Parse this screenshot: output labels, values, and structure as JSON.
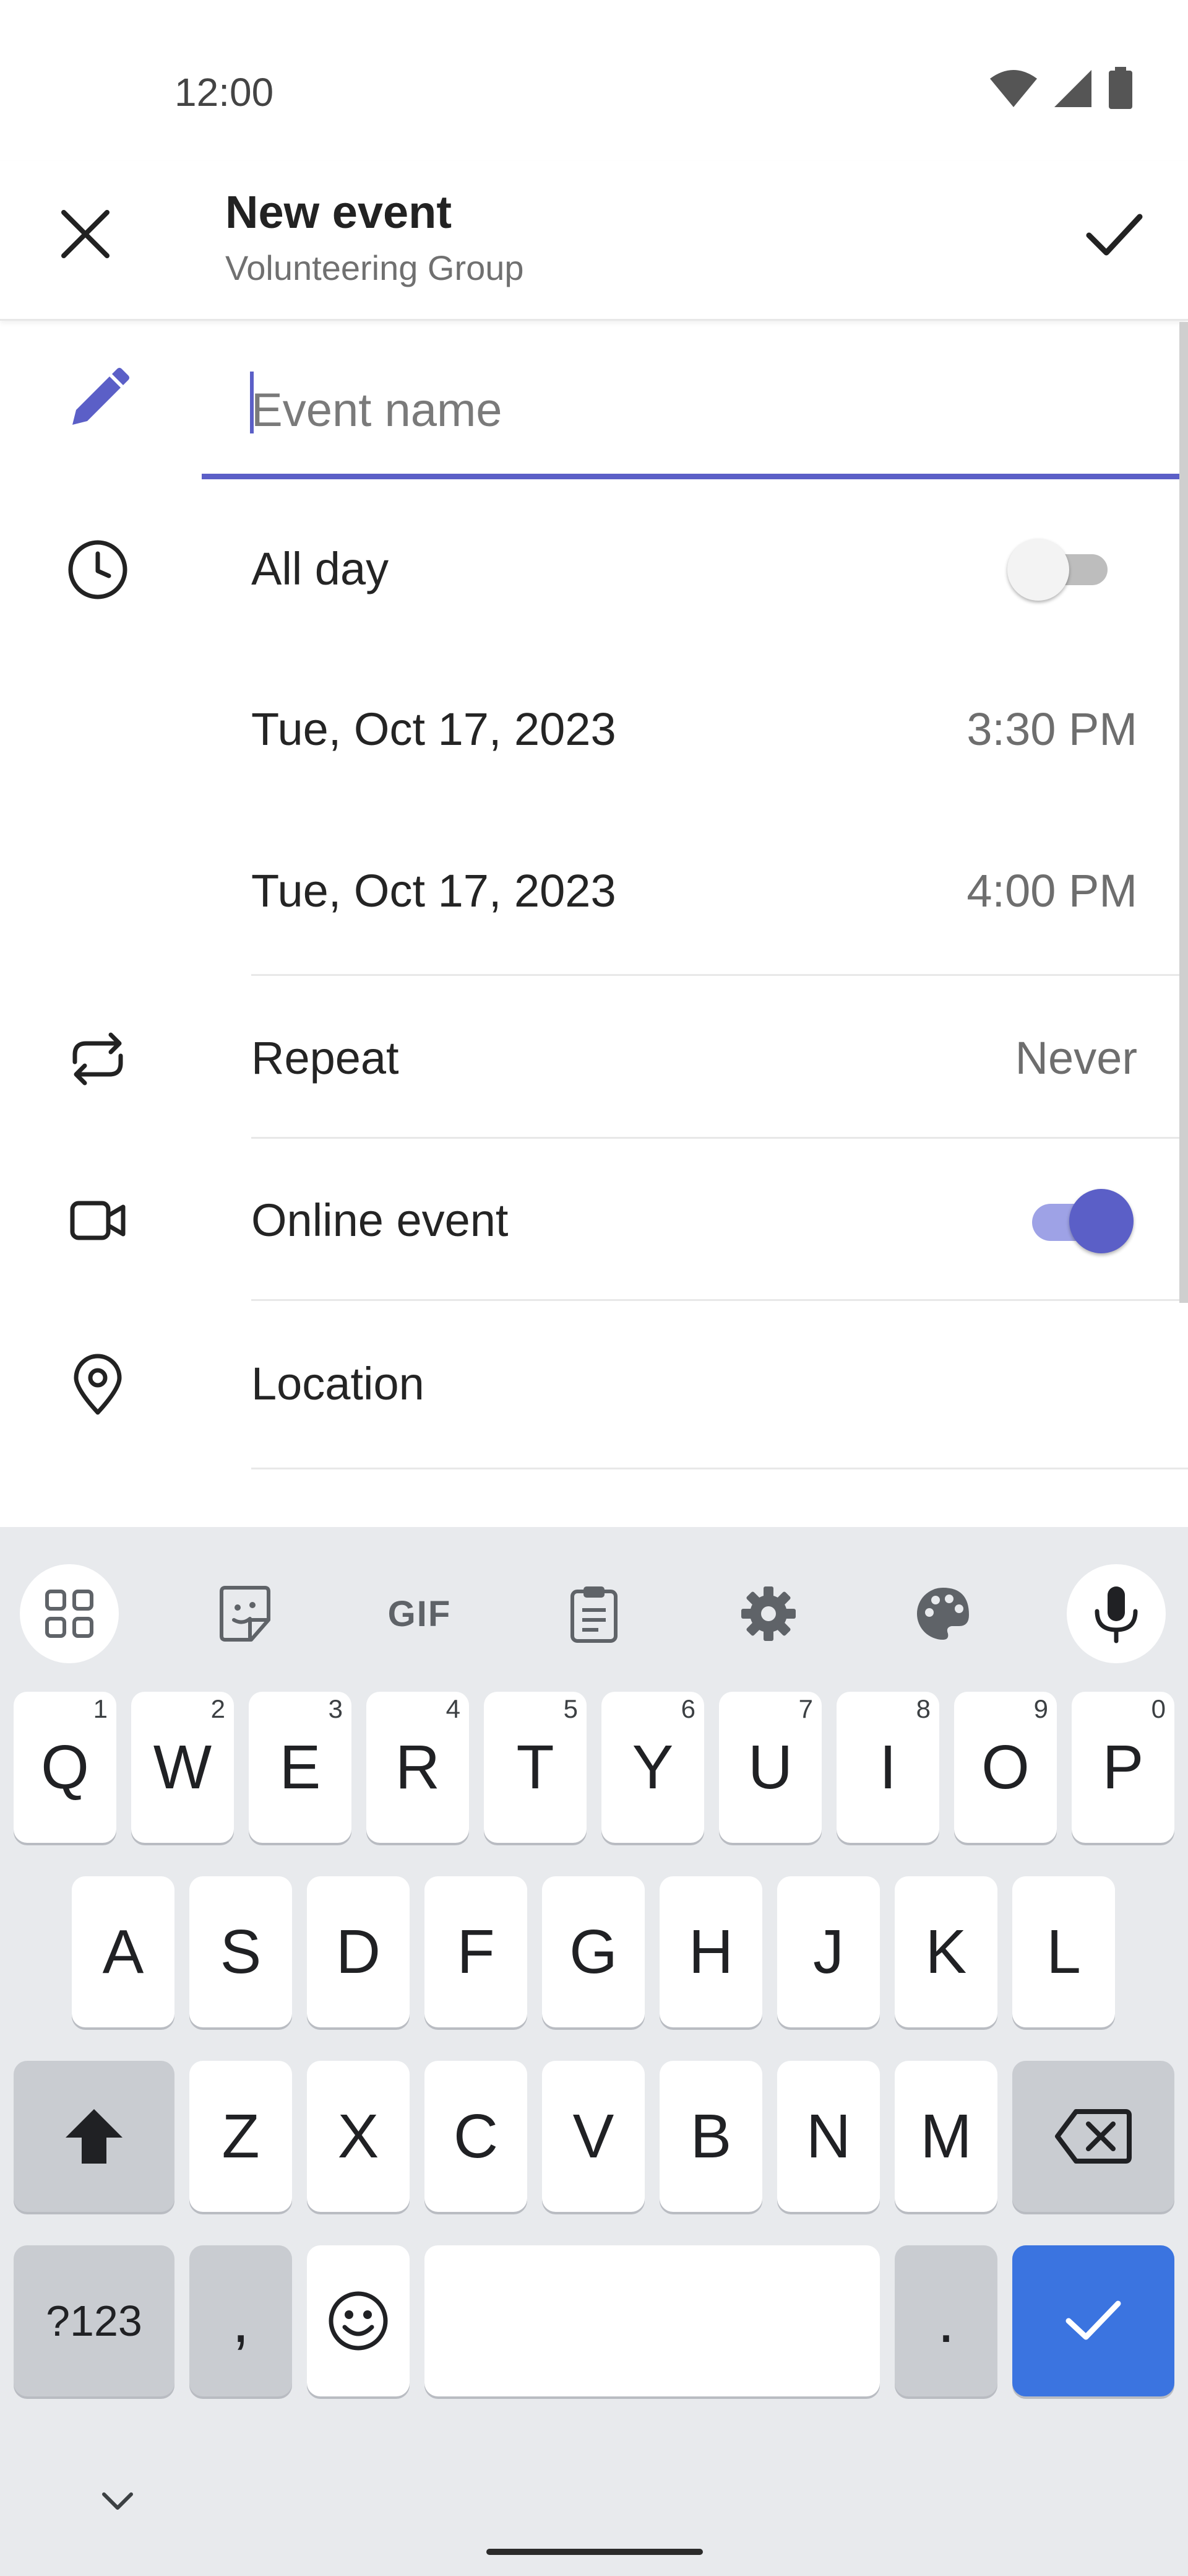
{
  "status_bar": {
    "time": "12:00"
  },
  "header": {
    "title": "New event",
    "subtitle": "Volunteering Group",
    "close_icon": "close-icon",
    "confirm_icon": "check-icon"
  },
  "form": {
    "event_name": {
      "placeholder": "Event name",
      "value": ""
    },
    "all_day": {
      "label": "All day",
      "on": false
    },
    "start": {
      "date": "Tue, Oct 17, 2023",
      "time": "3:30 PM"
    },
    "end": {
      "date": "Tue, Oct 17, 2023",
      "time": "4:00 PM"
    },
    "repeat": {
      "label": "Repeat",
      "value": "Never"
    },
    "online_event": {
      "label": "Online event",
      "on": true
    },
    "location": {
      "label": "Location"
    }
  },
  "keyboard": {
    "tools": [
      "apps-grid-icon",
      "sticker-icon",
      "gif-icon",
      "clipboard-icon",
      "settings-icon",
      "palette-icon",
      "mic-icon"
    ],
    "gif_label": "GIF",
    "row1": [
      {
        "key": "Q",
        "hint": "1"
      },
      {
        "key": "W",
        "hint": "2"
      },
      {
        "key": "E",
        "hint": "3"
      },
      {
        "key": "R",
        "hint": "4"
      },
      {
        "key": "T",
        "hint": "5"
      },
      {
        "key": "Y",
        "hint": "6"
      },
      {
        "key": "U",
        "hint": "7"
      },
      {
        "key": "I",
        "hint": "8"
      },
      {
        "key": "O",
        "hint": "9"
      },
      {
        "key": "P",
        "hint": "0"
      }
    ],
    "row2": [
      "A",
      "S",
      "D",
      "F",
      "G",
      "H",
      "J",
      "K",
      "L"
    ],
    "row3": [
      "Z",
      "X",
      "C",
      "V",
      "B",
      "N",
      "M"
    ],
    "symbols_label": "?123",
    "comma_label": ",",
    "period_label": "."
  },
  "colors": {
    "accent": "#5b5fc7",
    "keyboard_bg": "#e8eaed",
    "enter_key": "#3b74e0"
  }
}
